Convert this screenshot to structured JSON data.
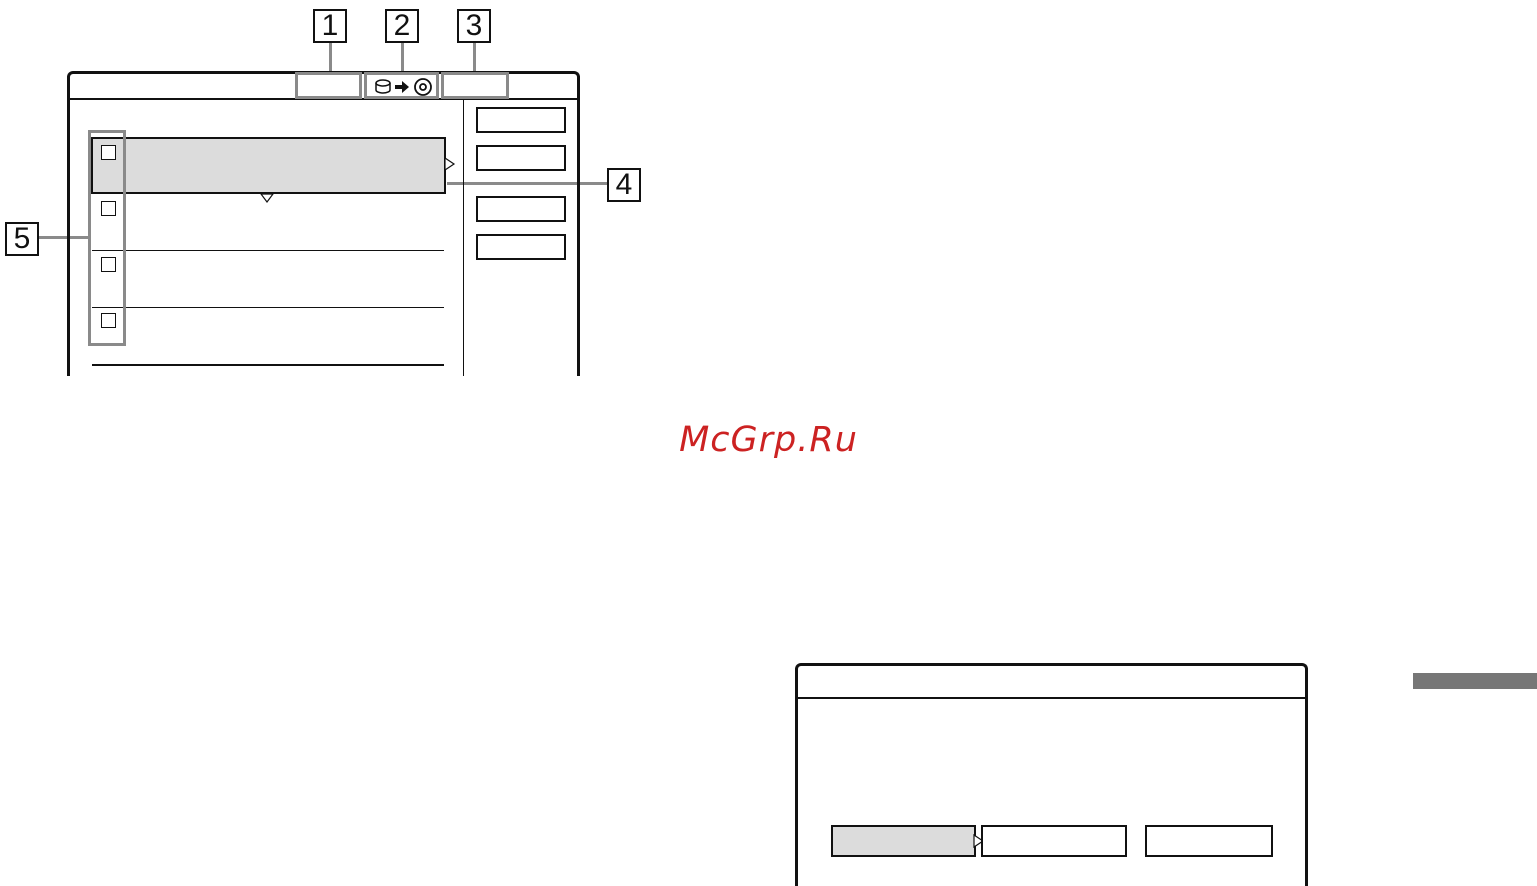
{
  "callouts": {
    "c1": "1",
    "c2": "2",
    "c3": "3",
    "c4": "4",
    "c5": "5"
  },
  "watermark": "McGrp.Ru",
  "icons": {
    "source": "hdd-icon",
    "arrow": "arrow-right-icon",
    "target": "disc-icon"
  },
  "colors": {
    "highlight": "#dcdcdc",
    "callout_frame": "#8a8a8a",
    "watermark": "#cc2222"
  }
}
